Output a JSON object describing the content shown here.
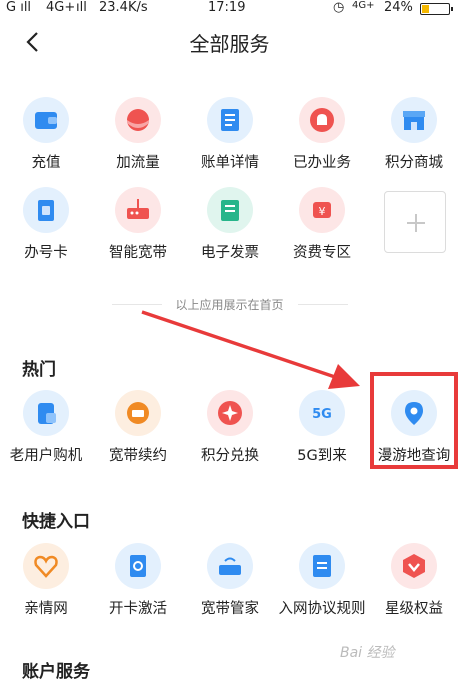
{
  "status_bar": {
    "network": "4G+",
    "speed": "23.4K/s",
    "time": "17:19",
    "network2": "4G+",
    "battery": "24%",
    "battery_level": 0.24
  },
  "header": {
    "title": "全部服务"
  },
  "home_apps": [
    {
      "label": "充值",
      "icon": "wallet-icon"
    },
    {
      "label": "加流量",
      "icon": "data-icon"
    },
    {
      "label": "账单详情",
      "icon": "bill-icon"
    },
    {
      "label": "已办业务",
      "icon": "bell-icon"
    },
    {
      "label": "积分商城",
      "icon": "shop-icon"
    },
    {
      "label": "办号卡",
      "icon": "sim-icon"
    },
    {
      "label": "智能宽带",
      "icon": "router-icon"
    },
    {
      "label": "电子发票",
      "icon": "receipt-icon"
    },
    {
      "label": "资费专区",
      "icon": "yen-icon"
    }
  ],
  "divider_text": "以上应用展示在首页",
  "hot": {
    "title": "热门",
    "items": [
      {
        "label": "老用户购机",
        "icon": "phone-bag-icon"
      },
      {
        "label": "宽带续约",
        "icon": "broadband-icon"
      },
      {
        "label": "积分兑换",
        "icon": "star-icon"
      },
      {
        "label": "5G到来",
        "icon": "5g-icon"
      },
      {
        "label": "漫游地查询",
        "icon": "location-icon"
      }
    ]
  },
  "shortcuts": {
    "title": "快捷入口",
    "items": [
      {
        "label": "亲情网",
        "icon": "heart-icon"
      },
      {
        "label": "开卡激活",
        "icon": "card-activate-icon"
      },
      {
        "label": "宽带管家",
        "icon": "router-manage-icon"
      },
      {
        "label": "入网协议规则",
        "icon": "agreement-icon"
      },
      {
        "label": "星级权益",
        "icon": "badge-icon"
      }
    ]
  },
  "account": {
    "title": "账户服务"
  },
  "watermark": "Bai 经验",
  "colors": {
    "highlight": "#e83a3a",
    "arrow": "#e83a3a",
    "accent_blue": "#2f8bf0"
  }
}
